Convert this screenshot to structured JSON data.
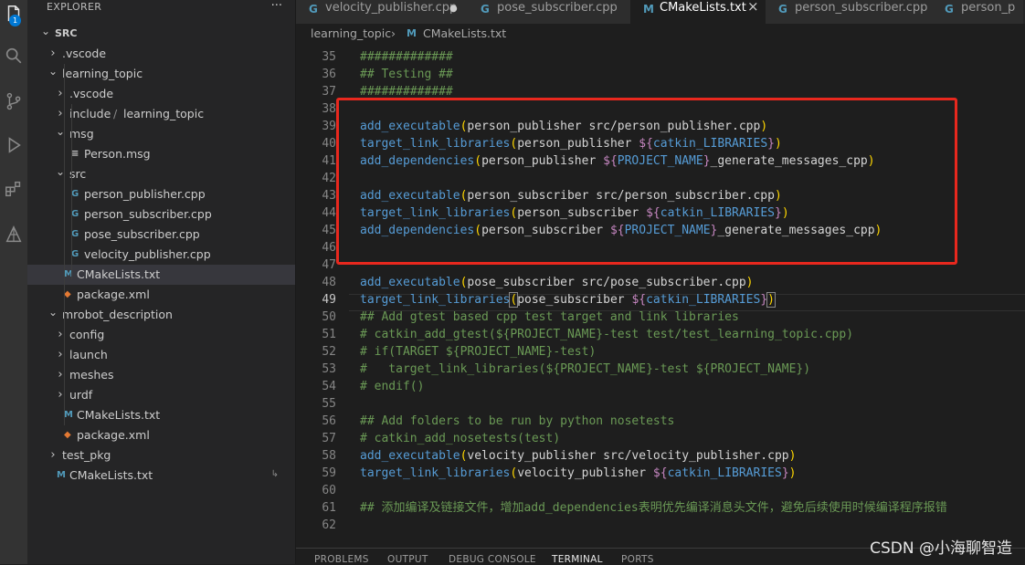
{
  "activity_bar": {
    "badge": "1",
    "icons": [
      "explorer-icon",
      "search-icon",
      "source-control-icon",
      "run-debug-icon",
      "extensions-icon",
      "ros-icon"
    ]
  },
  "sidebar": {
    "title": "EXPLORER",
    "more": "···",
    "tree": [
      {
        "label": "SRC",
        "kind": "root",
        "expanded": true
      },
      {
        "label": ".vscode",
        "kind": "folder",
        "expanded": false
      },
      {
        "label": "learning_topic",
        "kind": "folder",
        "expanded": true
      },
      {
        "label": ".vscode",
        "kind": "folder",
        "expanded": false
      },
      {
        "label": "include",
        "label2": "learning_topic",
        "kind": "folder",
        "expanded": false
      },
      {
        "label": "msg",
        "kind": "folder",
        "expanded": true
      },
      {
        "label": "Person.msg",
        "kind": "msg-file",
        "icon": "≡"
      },
      {
        "label": "src",
        "kind": "folder",
        "expanded": true
      },
      {
        "label": "person_publisher.cpp",
        "kind": "cpp-file",
        "icon": "G"
      },
      {
        "label": "person_subscriber.cpp",
        "kind": "cpp-file",
        "icon": "G"
      },
      {
        "label": "pose_subscriber.cpp",
        "kind": "cpp-file",
        "icon": "G"
      },
      {
        "label": "velocity_publisher.cpp",
        "kind": "cpp-file",
        "icon": "G"
      },
      {
        "label": "CMakeLists.txt",
        "kind": "cmake-file",
        "icon": "M",
        "selected": true
      },
      {
        "label": "package.xml",
        "kind": "xml-file",
        "icon": "◆"
      },
      {
        "label": "mrobot_description",
        "kind": "folder",
        "expanded": true
      },
      {
        "label": "config",
        "kind": "folder",
        "expanded": false
      },
      {
        "label": "launch",
        "kind": "folder",
        "expanded": false
      },
      {
        "label": "meshes",
        "kind": "folder",
        "expanded": false
      },
      {
        "label": "urdf",
        "kind": "folder",
        "expanded": false
      },
      {
        "label": "CMakeLists.txt",
        "kind": "cmake-file",
        "icon": "M"
      },
      {
        "label": "package.xml",
        "kind": "xml-file",
        "icon": "◆"
      },
      {
        "label": "test_pkg",
        "kind": "folder",
        "expanded": false
      },
      {
        "label": "CMakeLists.txt",
        "kind": "cmake-file",
        "icon": "M"
      }
    ]
  },
  "tabs": [
    {
      "label": "velocity_publisher.cpp",
      "icon": "G",
      "modified": true
    },
    {
      "label": "pose_subscriber.cpp",
      "icon": "G"
    },
    {
      "label": "CMakeLists.txt",
      "icon": "M",
      "active": true,
      "close": "×"
    },
    {
      "label": "person_subscriber.cpp",
      "icon": "G"
    },
    {
      "label": "person_p",
      "icon": "G"
    }
  ],
  "breadcrumb": {
    "folder": "learning_topic",
    "sep": "›",
    "icon": "M",
    "file": "CMakeLists.txt"
  },
  "editor": {
    "current_line": 49,
    "lines": [
      {
        "n": 35,
        "tokens": [
          [
            "c",
            "#############"
          ]
        ]
      },
      {
        "n": 36,
        "tokens": [
          [
            "c",
            "## Testing ##"
          ]
        ]
      },
      {
        "n": 37,
        "tokens": [
          [
            "c",
            "#############"
          ]
        ]
      },
      {
        "n": 38,
        "tokens": []
      },
      {
        "n": 39,
        "tokens": [
          [
            "f",
            "add_executable"
          ],
          [
            "y",
            "("
          ],
          [
            "t",
            "person_publisher src/person_publisher.cpp"
          ],
          [
            "y",
            ")"
          ]
        ]
      },
      {
        "n": 40,
        "tokens": [
          [
            "f",
            "target_link_libraries"
          ],
          [
            "y",
            "("
          ],
          [
            "t",
            "person_publisher "
          ],
          [
            "k",
            "${"
          ],
          [
            "v",
            "catkin_LIBRARIES"
          ],
          [
            "k",
            "}"
          ],
          [
            "y",
            ")"
          ]
        ]
      },
      {
        "n": 41,
        "tokens": [
          [
            "f",
            "add_dependencies"
          ],
          [
            "y",
            "("
          ],
          [
            "t",
            "person_publisher "
          ],
          [
            "k",
            "${"
          ],
          [
            "v",
            "PROJECT_NAME"
          ],
          [
            "k",
            "}"
          ],
          [
            "t",
            "_generate_messages_cpp"
          ],
          [
            "y",
            ")"
          ]
        ]
      },
      {
        "n": 42,
        "tokens": []
      },
      {
        "n": 43,
        "tokens": [
          [
            "f",
            "add_executable"
          ],
          [
            "y",
            "("
          ],
          [
            "t",
            "person_subscriber src/person_subscriber.cpp"
          ],
          [
            "y",
            ")"
          ]
        ]
      },
      {
        "n": 44,
        "tokens": [
          [
            "f",
            "target_link_libraries"
          ],
          [
            "y",
            "("
          ],
          [
            "t",
            "person_subscriber "
          ],
          [
            "k",
            "${"
          ],
          [
            "v",
            "catkin_LIBRARIES"
          ],
          [
            "k",
            "}"
          ],
          [
            "y",
            ")"
          ]
        ]
      },
      {
        "n": 45,
        "tokens": [
          [
            "f",
            "add_dependencies"
          ],
          [
            "y",
            "("
          ],
          [
            "t",
            "person_subscriber "
          ],
          [
            "k",
            "${"
          ],
          [
            "v",
            "PROJECT_NAME"
          ],
          [
            "k",
            "}"
          ],
          [
            "t",
            "_generate_messages_cpp"
          ],
          [
            "y",
            ")"
          ]
        ]
      },
      {
        "n": 46,
        "tokens": []
      },
      {
        "n": 47,
        "tokens": []
      },
      {
        "n": 48,
        "tokens": [
          [
            "f",
            "add_executable"
          ],
          [
            "y",
            "("
          ],
          [
            "t",
            "pose_subscriber src/pose_subscriber.cpp"
          ],
          [
            "y",
            ")"
          ]
        ]
      },
      {
        "n": 49,
        "tokens": [
          [
            "f",
            "target_link_libraries"
          ],
          [
            "y",
            "("
          ],
          [
            "t",
            "pose_subscriber "
          ],
          [
            "k",
            "${"
          ],
          [
            "v",
            "catkin_LIBRARIES"
          ],
          [
            "k",
            "}"
          ],
          [
            "y",
            ")"
          ]
        ]
      },
      {
        "n": 50,
        "tokens": [
          [
            "c",
            "## Add gtest based cpp test target and link libraries"
          ]
        ]
      },
      {
        "n": 51,
        "tokens": [
          [
            "c",
            "# catkin_add_gtest(${PROJECT_NAME}-test test/test_learning_topic.cpp)"
          ]
        ]
      },
      {
        "n": 52,
        "tokens": [
          [
            "c",
            "# if(TARGET ${PROJECT_NAME}-test)"
          ]
        ]
      },
      {
        "n": 53,
        "tokens": [
          [
            "c",
            "#   target_link_libraries(${PROJECT_NAME}-test ${PROJECT_NAME})"
          ]
        ]
      },
      {
        "n": 54,
        "tokens": [
          [
            "c",
            "# endif()"
          ]
        ]
      },
      {
        "n": 55,
        "tokens": []
      },
      {
        "n": 56,
        "tokens": [
          [
            "c",
            "## Add folders to be run by python nosetests"
          ]
        ]
      },
      {
        "n": 57,
        "tokens": [
          [
            "c",
            "# catkin_add_nosetests(test)"
          ]
        ]
      },
      {
        "n": 58,
        "tokens": [
          [
            "f",
            "add_executable"
          ],
          [
            "y",
            "("
          ],
          [
            "t",
            "velocity_publisher src/velocity_publisher.cpp"
          ],
          [
            "y",
            ")"
          ]
        ]
      },
      {
        "n": 59,
        "tokens": [
          [
            "f",
            "target_link_libraries"
          ],
          [
            "y",
            "("
          ],
          [
            "t",
            "velocity_publisher "
          ],
          [
            "k",
            "${"
          ],
          [
            "v",
            "catkin_LIBRARIES"
          ],
          [
            "k",
            "}"
          ],
          [
            "y",
            ")"
          ]
        ]
      },
      {
        "n": 60,
        "tokens": []
      },
      {
        "n": 61,
        "tokens": [
          [
            "c",
            "## 添加编译及链接文件，增加add_dependencies表明优先编译消息头文件，避免后续使用时候编译程序报错"
          ]
        ]
      },
      {
        "n": 62,
        "tokens": []
      }
    ]
  },
  "panel_tabs": [
    {
      "label": "PROBLEMS"
    },
    {
      "label": "OUTPUT"
    },
    {
      "label": "DEBUG CONSOLE"
    },
    {
      "label": "TERMINAL",
      "active": true
    },
    {
      "label": "PORTS"
    }
  ],
  "watermark": "CSDN @小海聊智造",
  "colors": {
    "func": "#569cd6",
    "text": "#d4d4d4",
    "comment": "#6a9955",
    "paren": "#ffd700",
    "dollar": "#c586c0",
    "var": "#569cd6",
    "highlight_box": "#e8281e",
    "cpp_icon": "#519aba",
    "cmake_icon": "#519aba",
    "xml_icon": "#e37933"
  }
}
